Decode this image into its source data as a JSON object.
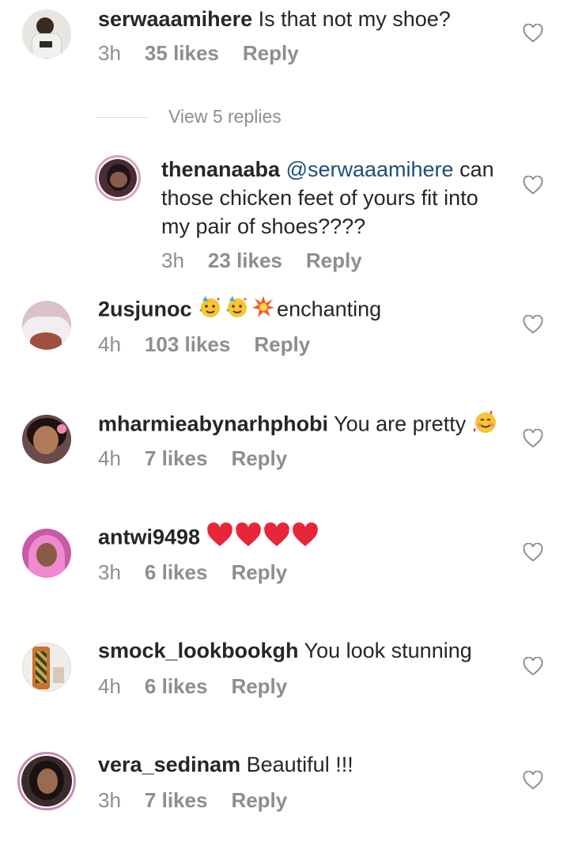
{
  "comments": [
    {
      "user": "serwaaamihere",
      "text": " Is that not my shoe?",
      "time": "3h",
      "likes": "35 likes",
      "reply": "Reply"
    },
    {
      "user": "thenanaaba",
      "mention": "@serwaaamihere",
      "text_line1": " can",
      "text_line2": "those chicken feet of yours fit into",
      "text_line3": "my pair of shoes????",
      "time": "3h",
      "likes": "23 likes",
      "reply": "Reply"
    },
    {
      "user": "2usjunoc",
      "text": "enchanting",
      "time": "4h",
      "likes": "103 likes",
      "reply": "Reply"
    },
    {
      "user": "mharmieabynarhphobi",
      "text": " You are pretty ",
      "time": "4h",
      "likes": "7 likes",
      "reply": "Reply"
    },
    {
      "user": "antwi9498",
      "text": " ",
      "time": "3h",
      "likes": "6 likes",
      "reply": "Reply"
    },
    {
      "user": "smock_lookbookgh",
      "text": " You look stunning",
      "time": "4h",
      "likes": "6 likes",
      "reply": "Reply"
    },
    {
      "user": "vera_sedinam",
      "text": " Beautiful !!!",
      "time": "3h",
      "likes": "7 likes",
      "reply": "Reply"
    }
  ],
  "view_replies": "View 5 replies",
  "icons": {
    "like": "heart-outline-icon",
    "party": "partying-face-emoji",
    "spark": "collision-emoji",
    "hearts": "red-heart-emoji",
    "love": "smiling-face-with-hearts-emoji"
  }
}
